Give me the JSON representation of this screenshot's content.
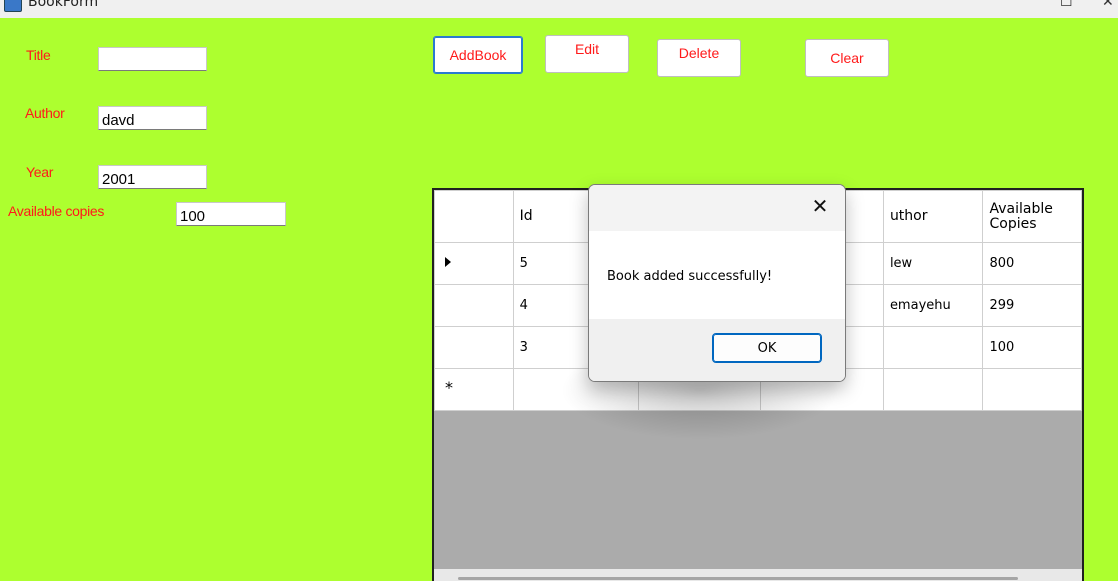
{
  "window": {
    "title": "BookForm",
    "icon": "form-icon",
    "maximize_glyph": "☐",
    "close_glyph": "✕"
  },
  "form": {
    "title_label": "Title",
    "title_value": "",
    "author_label": "Author",
    "author_value": "davd",
    "year_label": "Year",
    "year_value": "2001",
    "copies_label": "Available copies",
    "copies_value": "100",
    "label_color": "#ff1a1a",
    "background_color": "#adff2f"
  },
  "toolbar": {
    "add_label": "AddBook",
    "edit_label": "Edit",
    "delete_label": "Delete",
    "clear_label": "Clear"
  },
  "grid": {
    "columns": [
      "Id",
      "",
      "",
      "uthor",
      "Available\nCopies"
    ],
    "rows": [
      {
        "indicator": "current-row-arrow",
        "cells": [
          "5",
          "",
          "",
          "lew",
          "800"
        ]
      },
      {
        "indicator": "",
        "cells": [
          "4",
          "",
          "",
          "emayehu",
          "299"
        ]
      },
      {
        "indicator": "",
        "cells": [
          "3",
          "",
          "",
          "",
          "100"
        ]
      }
    ],
    "new_row_glyph": "*"
  },
  "dialog": {
    "close_glyph": "✕",
    "message": "Book added successfully!",
    "ok_label": "OK"
  }
}
